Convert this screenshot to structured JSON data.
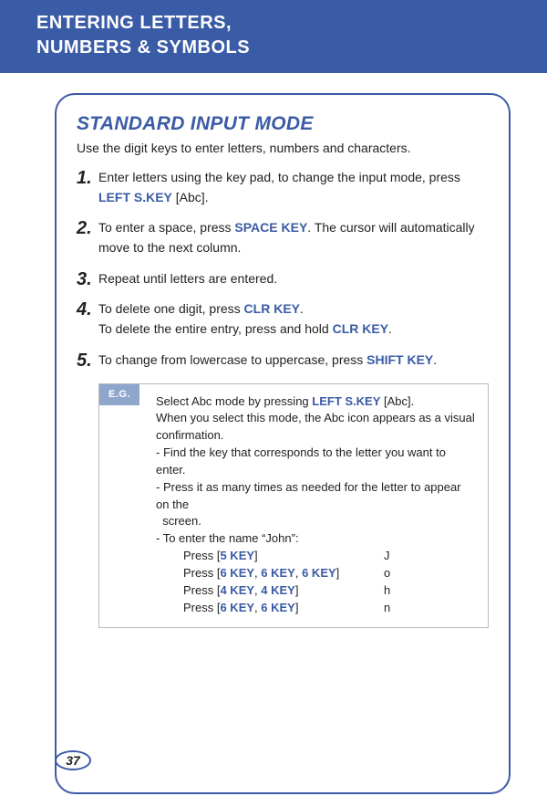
{
  "header": {
    "line1": "ENTERING LETTERS,",
    "line2": "NUMBERS & SYMBOLS"
  },
  "section": {
    "title": "STANDARD INPUT MODE",
    "intro": "Use the digit keys to enter letters, numbers and characters."
  },
  "steps": [
    {
      "num": "1.",
      "parts": [
        {
          "t": "Enter letters using the key pad, to change the input mode, press "
        },
        {
          "t": "LEFT S.KEY",
          "key": true
        },
        {
          "t": " [Abc]."
        }
      ]
    },
    {
      "num": "2.",
      "parts": [
        {
          "t": "To enter a space, press "
        },
        {
          "t": "SPACE KEY",
          "key": true
        },
        {
          "t": ". The cursor will automatically move to the next column."
        }
      ]
    },
    {
      "num": "3.",
      "parts": [
        {
          "t": "Repeat until letters are entered."
        }
      ]
    },
    {
      "num": "4.",
      "parts": [
        {
          "t": "To delete one digit, press "
        },
        {
          "t": "CLR KEY",
          "key": true
        },
        {
          "t": "."
        },
        {
          "br": true
        },
        {
          "t": "To delete the entire entry, press and hold "
        },
        {
          "t": "CLR KEY",
          "key": true
        },
        {
          "t": "."
        }
      ]
    },
    {
      "num": "5.",
      "parts": [
        {
          "t": "To change from lowercase to uppercase, press "
        },
        {
          "t": "SHIFT KEY",
          "key": true
        },
        {
          "t": "."
        }
      ]
    }
  ],
  "eg": {
    "label": "E.G.",
    "lines": [
      [
        {
          "t": "Select Abc mode by pressing "
        },
        {
          "t": "LEFT S.KEY",
          "key": true
        },
        {
          "t": " [Abc]."
        }
      ],
      [
        {
          "t": "When you select this mode, the Abc icon appears as a visual confirmation."
        }
      ],
      [
        {
          "t": "- Find the key that corresponds to the letter you want to enter."
        }
      ],
      [
        {
          "t": "- Press it as many times as needed for the letter to appear on the"
        }
      ],
      [
        {
          "t": "  screen."
        }
      ],
      [
        {
          "t": "- To enter the name “John”:"
        }
      ]
    ],
    "rows": [
      {
        "left": [
          {
            "t": "Press ["
          },
          {
            "t": "5 KEY",
            "key": true
          },
          {
            "t": "]"
          }
        ],
        "right": "J"
      },
      {
        "left": [
          {
            "t": "Press ["
          },
          {
            "t": "6 KEY",
            "key": true
          },
          {
            "t": ", "
          },
          {
            "t": "6 KEY",
            "key": true
          },
          {
            "t": ", "
          },
          {
            "t": "6 KEY",
            "key": true
          },
          {
            "t": "]"
          }
        ],
        "right": "o"
      },
      {
        "left": [
          {
            "t": "Press ["
          },
          {
            "t": "4 KEY",
            "key": true
          },
          {
            "t": ", "
          },
          {
            "t": "4 KEY",
            "key": true
          },
          {
            "t": "]"
          }
        ],
        "right": "h"
      },
      {
        "left": [
          {
            "t": "Press ["
          },
          {
            "t": "6 KEY",
            "key": true
          },
          {
            "t": ", "
          },
          {
            "t": "6 KEY",
            "key": true
          },
          {
            "t": "]"
          }
        ],
        "right": "n"
      }
    ]
  },
  "page": "37"
}
